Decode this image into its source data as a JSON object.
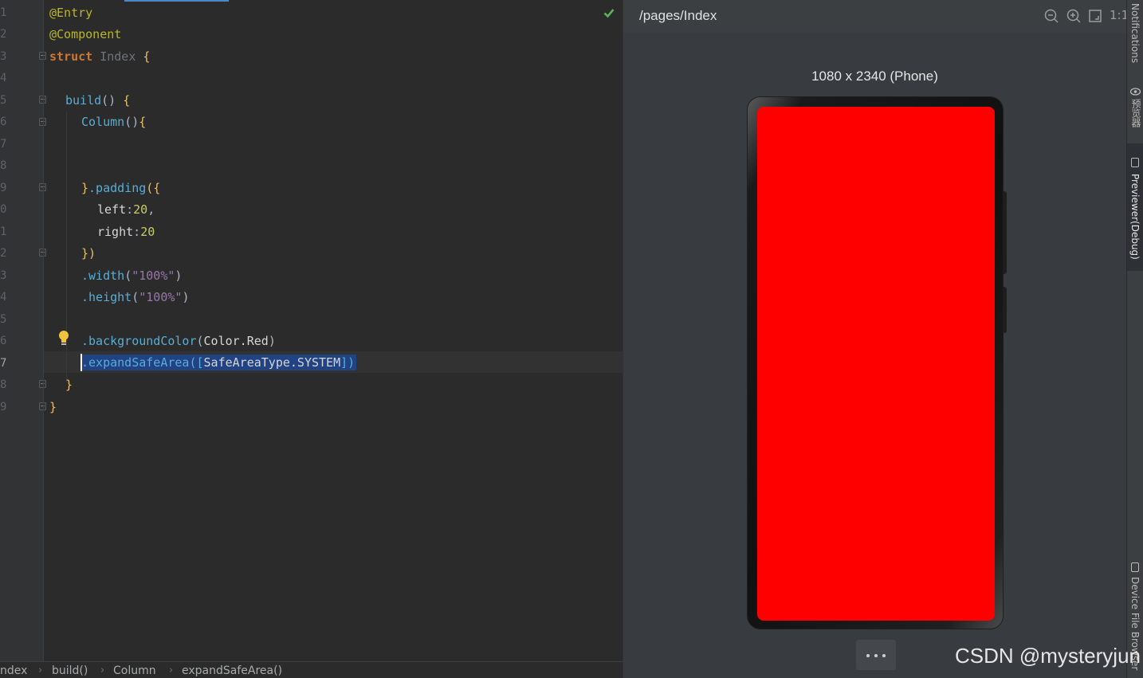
{
  "editor": {
    "line_numbers": [
      "1",
      "2",
      "3",
      "4",
      "5",
      "6",
      "7",
      "8",
      "9",
      "0",
      "1",
      "2",
      "3",
      "4",
      "5",
      "6",
      "7",
      "8",
      "9"
    ],
    "lines": {
      "l1": {
        "t": "@Entry"
      },
      "l2": {
        "t": "@Component"
      },
      "l3": {
        "kw": "struct",
        "cls": "Index",
        "br": "{"
      },
      "l5": {
        "fn": "build",
        "p": "()",
        "br": "{"
      },
      "l6": {
        "fn": "Column",
        "p": "()",
        "br": "{"
      },
      "l9": {
        "br": "}",
        "fn": ".padding",
        "p": "({"
      },
      "l10": {
        "id": "left",
        "c": ":",
        "num": "20",
        "comma": ","
      },
      "l11": {
        "id": "right",
        "c": ":",
        "num": "20"
      },
      "l12": {
        "p": "})"
      },
      "l13": {
        "fn": ".width",
        "p1": "(",
        "str": "\"100%\"",
        "p2": ")"
      },
      "l14": {
        "fn": ".height",
        "p1": "(",
        "str": "\"100%\"",
        "p2": ")"
      },
      "l16": {
        "fn": ".backgroundColor",
        "p1": "(",
        "id": "Color.Red",
        "p2": ")"
      },
      "l17": {
        "fn": ".expandSafeArea",
        "p1": "([",
        "id": "SafeAreaType.SYSTEM",
        "p2": "])"
      },
      "l18": {
        "br": "}"
      },
      "l19": {
        "br": "}"
      }
    }
  },
  "breadcrumb": [
    "ndex",
    "build()",
    "Column",
    "expandSafeArea()"
  ],
  "breadcrumb_separator": "›",
  "previewer": {
    "title": "/pages/Index",
    "zoom_reset": "1:1",
    "device_label": "1080 x 2340 (Phone)",
    "screen_color": "#ff0000"
  },
  "right_strip": {
    "notifications": "Notifications",
    "previewer_cn": "预览器",
    "previewer_debug": "Previewer(Debug)",
    "device_file_browser": "Device File Browser"
  },
  "watermark": "CSDN @mysteryjun",
  "icons": [
    "check-icon",
    "bulb-icon",
    "zoom-out-icon",
    "zoom-in-icon",
    "fit-screen-icon",
    "more-icon",
    "eye-icon",
    "phone-icon"
  ]
}
